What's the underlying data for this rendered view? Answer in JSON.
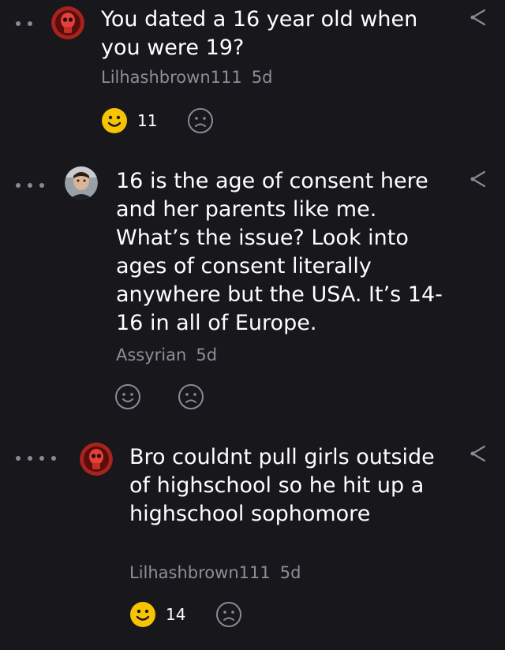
{
  "comments": [
    {
      "text": "You dated a 16 year old when you were 19?",
      "author": "Lilhashbrown111",
      "time": "5d",
      "likes": "11",
      "depth_dots": 2
    },
    {
      "text": "16 is the age of consent here and her parents like me. What’s the issue? Look into ages of consent literally anywhere but the USA. It’s 14-16 in all of Europe.",
      "author": "Assyrian",
      "time": "5d",
      "likes": "",
      "depth_dots": 3
    },
    {
      "text": "Bro couldnt pull girls outside of highschool so he hit up a highschool sophomore",
      "author": "Lilhashbrown111",
      "time": "5d",
      "likes": "14",
      "depth_dots": 4
    }
  ],
  "icons": {
    "share": "share-icon",
    "happy": "smiley-icon",
    "sad": "frown-icon"
  },
  "colors": {
    "background": "#17171c",
    "text": "#ffffff",
    "meta": "#8e8e99",
    "liked": "#f6c400",
    "icon": "#8a8a94"
  }
}
